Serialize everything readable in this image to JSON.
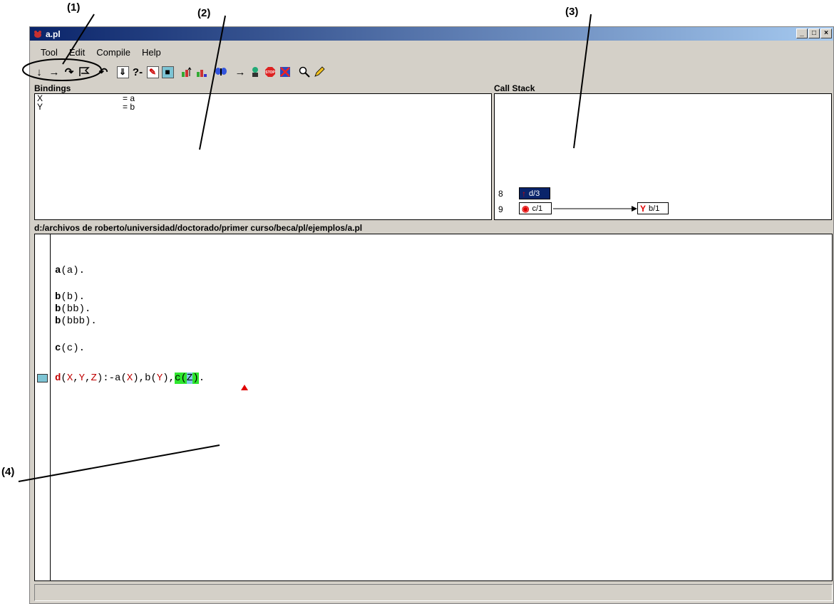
{
  "annotations": [
    "(1)",
    "(2)",
    "(3)",
    "(4)"
  ],
  "window": {
    "title": "a.pl",
    "controls": [
      "_",
      "□",
      "×"
    ]
  },
  "menu": [
    "Tool",
    "Edit",
    "Compile",
    "Help"
  ],
  "toolbar": {
    "icons": [
      "step-into-icon",
      "step-over-icon",
      "skip-icon",
      "leap-icon",
      "undo-icon",
      "trace-icon",
      "query-icon",
      "edit-spy-icon",
      "goal-icon",
      "up-icon",
      "down-icon",
      "butterfly-icon",
      "leave-icon",
      "spy-icon",
      "stop-icon",
      "abort-icon",
      "search-icon",
      "edit-icon"
    ],
    "query_label": "?-"
  },
  "bindings": {
    "label": "Bindings",
    "rows": [
      {
        "var": "X",
        "value": "= a"
      },
      {
        "var": "Y",
        "value": "= b"
      }
    ]
  },
  "call_stack": {
    "label": "Call Stack",
    "frames": [
      {
        "num": "8",
        "label": "d/3",
        "selected": true
      },
      {
        "num": "9",
        "label": "c/1",
        "selected": false
      },
      {
        "num": "",
        "label": "b/1",
        "selected": false
      }
    ]
  },
  "file_path": "d:/archivos de roberto/universidad/doctorado/primer curso/beca/pl/ejemplos/a.pl",
  "code": {
    "l1": {
      "head": "a",
      "rest": "(a)."
    },
    "l2": {
      "head": "b",
      "rest": "(b)."
    },
    "l3": {
      "head": "b",
      "rest": "(bb)."
    },
    "l4": {
      "head": "b",
      "rest": "(bbb)."
    },
    "l5": {
      "head": "c",
      "rest": "(c)."
    },
    "l6": {
      "head": "d",
      "p1": "(",
      "v1": "X",
      "c1": ",",
      "v2": "Y",
      "c2": ",",
      "v3": "Z",
      "p2": "):-a(",
      "v4": "X",
      "p3": "),b(",
      "v5": "Y",
      "p4": "),",
      "hl_c": "c",
      "hl_p": "(",
      "hl_v": "Z",
      "hl_close": ")",
      "end": "."
    }
  },
  "status": ""
}
